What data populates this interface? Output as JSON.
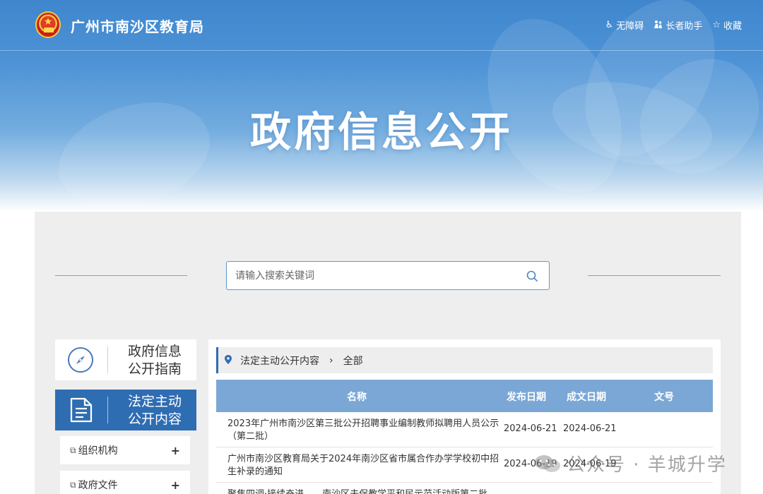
{
  "header": {
    "site_title": "广州市南沙区教育局",
    "tools": [
      {
        "icon": "accessibility-icon",
        "label": "无障碍"
      },
      {
        "icon": "elder-icon",
        "label": "长者助手"
      },
      {
        "icon": "star-icon",
        "label": "收藏"
      }
    ]
  },
  "hero": {
    "title": "政府信息公开"
  },
  "search": {
    "placeholder": "请输入搜索关键词"
  },
  "sidebar": {
    "guide_card": {
      "icon": "compass-icon",
      "label": "政府信息公开指南"
    },
    "content_card": {
      "icon": "document-icon",
      "label": "法定主动公开内容"
    },
    "items": [
      {
        "icon": "copy-icon",
        "label": "组织机构"
      },
      {
        "icon": "copy-icon",
        "label": "政府文件"
      }
    ]
  },
  "content": {
    "breadcrumb": [
      "法定主动公开内容",
      "全部"
    ],
    "columns": [
      "名称",
      "发布日期",
      "成文日期",
      "文号"
    ],
    "rows": [
      {
        "name": "2023年广州市南沙区第三批公开招聘事业编制教师拟聘用人员公示（第二批）",
        "published": "2024-06-21",
        "written": "2024-06-21",
        "number": ""
      },
      {
        "name": "广州市南沙区教育局关于2024年南沙区省市属合作办学学校初中招生补录的通知",
        "published": "2024-06-19",
        "written": "2024-06-19",
        "number": ""
      },
      {
        "name": "聚焦四调·接续奋进——南沙区未保教学平和民示范活动版第二批",
        "published": "",
        "written": "",
        "number": ""
      }
    ]
  },
  "watermark": {
    "text": "公众号 · 羊城升学"
  },
  "colors": {
    "brand_blue": "#2f6db2",
    "table_header": "#7ba7d6",
    "panel_bg": "#eeeeee"
  }
}
